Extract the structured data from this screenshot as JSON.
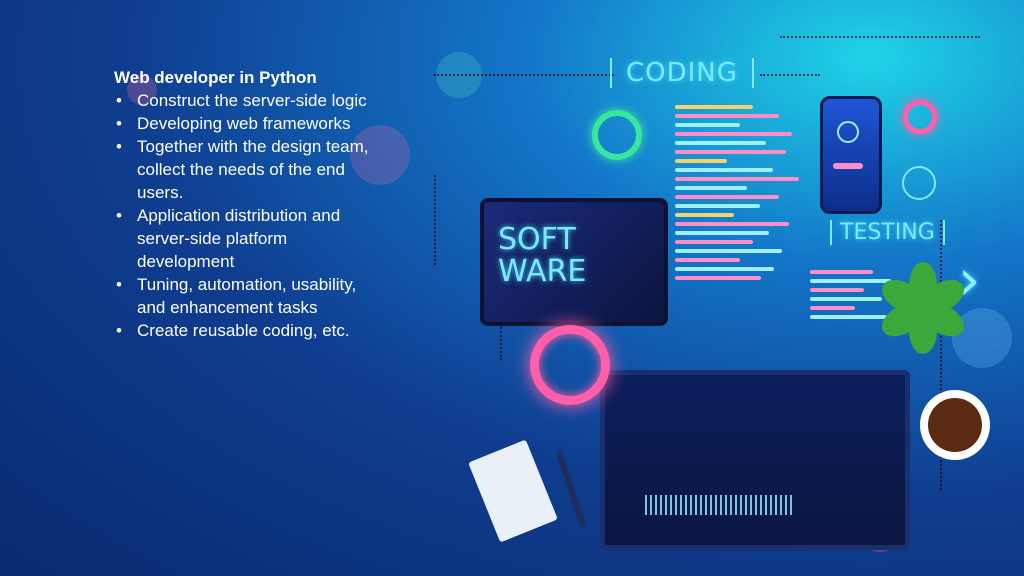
{
  "slide": {
    "title": "Web developer in Python",
    "bullets": [
      "Construct the server-side logic",
      "Developing web frameworks",
      "Together with the design team, collect the needs of the end users.",
      "Application distribution and server-side platform development",
      "Tuning, automation, usability, and enhancement tasks",
      "Create reusable coding, etc."
    ]
  },
  "illustration": {
    "coding_label": "CODING",
    "software_line1": "SOFT",
    "software_line2": "WARE",
    "testing_label": "TESTING"
  },
  "colors": {
    "background_dark": "#0a2a6e",
    "background_light": "#1fd3e6",
    "neon": "#7fe9ff",
    "ring_pink": "#ff5ea8",
    "ring_green": "#39e6a0"
  }
}
